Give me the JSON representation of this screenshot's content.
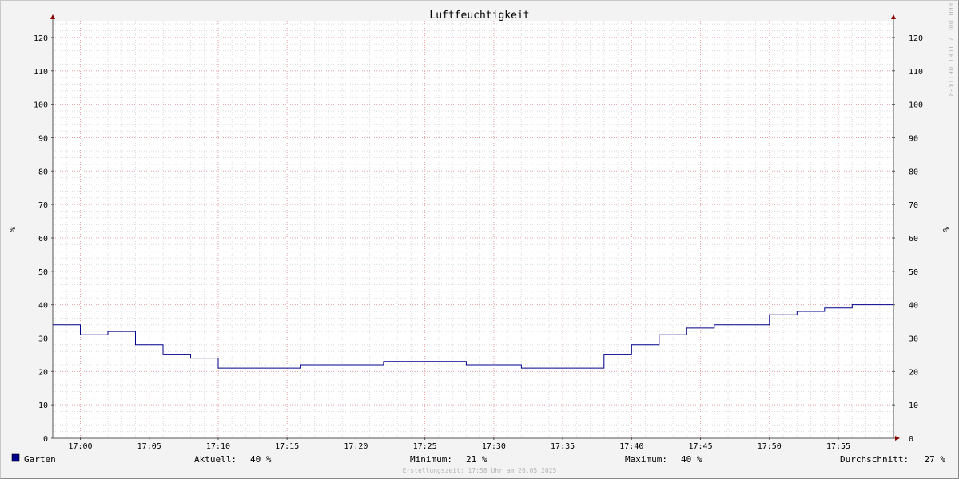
{
  "chart_data": {
    "type": "line",
    "title": "Luftfeuchtigkeit",
    "ylabel": "%",
    "ylabel_right": "%",
    "ylim": [
      0,
      125
    ],
    "yticks": [
      0,
      10,
      20,
      30,
      40,
      50,
      60,
      70,
      80,
      90,
      100,
      110,
      120
    ],
    "xlim": [
      "16:58",
      "17:59"
    ],
    "xticks": [
      "17:00",
      "17:05",
      "17:10",
      "17:15",
      "17:20",
      "17:25",
      "17:30",
      "17:35",
      "17:40",
      "17:45",
      "17:50",
      "17:55"
    ],
    "grid": true,
    "series": [
      {
        "name": "Garten",
        "color": "#00008b",
        "step": true,
        "points": [
          {
            "t": "16:58",
            "v": 34
          },
          {
            "t": "17:00",
            "v": 31
          },
          {
            "t": "17:02",
            "v": 32
          },
          {
            "t": "17:04",
            "v": 28
          },
          {
            "t": "17:06",
            "v": 25
          },
          {
            "t": "17:08",
            "v": 24
          },
          {
            "t": "17:10",
            "v": 21
          },
          {
            "t": "17:16",
            "v": 22
          },
          {
            "t": "17:22",
            "v": 23
          },
          {
            "t": "17:28",
            "v": 22
          },
          {
            "t": "17:32",
            "v": 21
          },
          {
            "t": "17:38",
            "v": 25
          },
          {
            "t": "17:40",
            "v": 28
          },
          {
            "t": "17:42",
            "v": 31
          },
          {
            "t": "17:44",
            "v": 33
          },
          {
            "t": "17:46",
            "v": 34
          },
          {
            "t": "17:50",
            "v": 37
          },
          {
            "t": "17:52",
            "v": 38
          },
          {
            "t": "17:54",
            "v": 39
          },
          {
            "t": "17:56",
            "v": 40
          },
          {
            "t": "17:59",
            "v": 40
          }
        ]
      }
    ],
    "legend": {
      "series_label": "Garten",
      "series_color": "#00008b",
      "stats": [
        {
          "label": "Aktuell:",
          "value": "40 %"
        },
        {
          "label": "Minimum:",
          "value": "21 %"
        },
        {
          "label": "Maximum:",
          "value": "40 %"
        },
        {
          "label": "Durchschnitt:",
          "value": "27 %"
        }
      ]
    },
    "watermark": "RRDTOOL / TOBI OETIKER",
    "footer": "Erstellungszeit: 17:58 Uhr am 26.05.2025"
  }
}
